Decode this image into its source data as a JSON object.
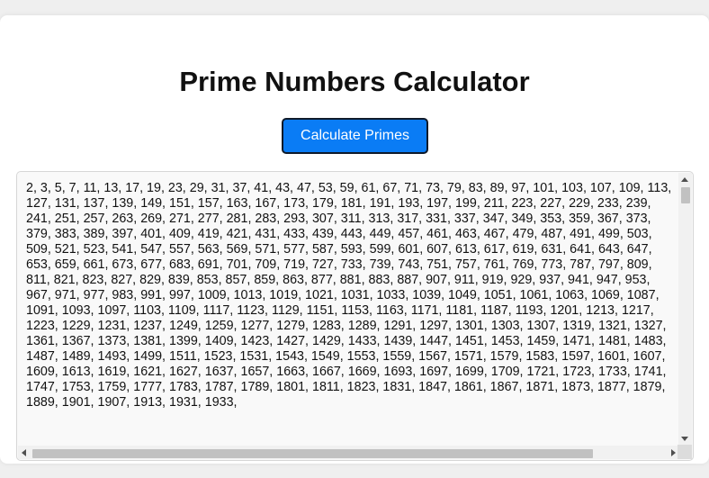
{
  "header": {
    "title": "Prime Numbers Calculator"
  },
  "controls": {
    "calculate_label": "Calculate Primes"
  },
  "output": {
    "primes_text": "2, 3, 5, 7, 11, 13, 17, 19, 23, 29, 31, 37, 41, 43, 47, 53, 59, 61, 67, 71, 73, 79, 83, 89, 97, 101, 103, 107, 109, 113, 127, 131, 137, 139, 149, 151, 157, 163, 167, 173, 179, 181, 191, 193, 197, 199, 211, 223, 227, 229, 233, 239, 241, 251, 257, 263, 269, 271, 277, 281, 283, 293, 307, 311, 313, 317, 331, 337, 347, 349, 353, 359, 367, 373, 379, 383, 389, 397, 401, 409, 419, 421, 431, 433, 439, 443, 449, 457, 461, 463, 467, 479, 487, 491, 499, 503, 509, 521, 523, 541, 547, 557, 563, 569, 571, 577, 587, 593, 599, 601, 607, 613, 617, 619, 631, 641, 643, 647, 653, 659, 661, 673, 677, 683, 691, 701, 709, 719, 727, 733, 739, 743, 751, 757, 761, 769, 773, 787, 797, 809, 811, 821, 823, 827, 829, 839, 853, 857, 859, 863, 877, 881, 883, 887, 907, 911, 919, 929, 937, 941, 947, 953, 967, 971, 977, 983, 991, 997, 1009, 1013, 1019, 1021, 1031, 1033, 1039, 1049, 1051, 1061, 1063, 1069, 1087, 1091, 1093, 1097, 1103, 1109, 1117, 1123, 1129, 1151, 1153, 1163, 1171, 1181, 1187, 1193, 1201, 1213, 1217, 1223, 1229, 1231, 1237, 1249, 1259, 1277, 1279, 1283, 1289, 1291, 1297, 1301, 1303, 1307, 1319, 1321, 1327, 1361, 1367, 1373, 1381, 1399, 1409, 1423, 1427, 1429, 1433, 1439, 1447, 1451, 1453, 1459, 1471, 1481, 1483, 1487, 1489, 1493, 1499, 1511, 1523, 1531, 1543, 1549, 1553, 1559, 1567, 1571, 1579, 1583, 1597, 1601, 1607, 1609, 1613, 1619, 1621, 1627, 1637, 1657, 1663, 1667, 1669, 1693, 1697, 1699, 1709, 1721, 1723, 1733, 1741, 1747, 1753, 1759, 1777, 1783, 1787, 1789, 1801, 1811, 1823, 1831, 1847, 1861, 1867, 1871, 1873, 1877, 1879, 1889, 1901, 1907, 1913, 1931, 1933,"
  },
  "colors": {
    "button_bg": "#0a7cf5",
    "page_bg": "#efefef",
    "card_bg": "#ffffff"
  }
}
